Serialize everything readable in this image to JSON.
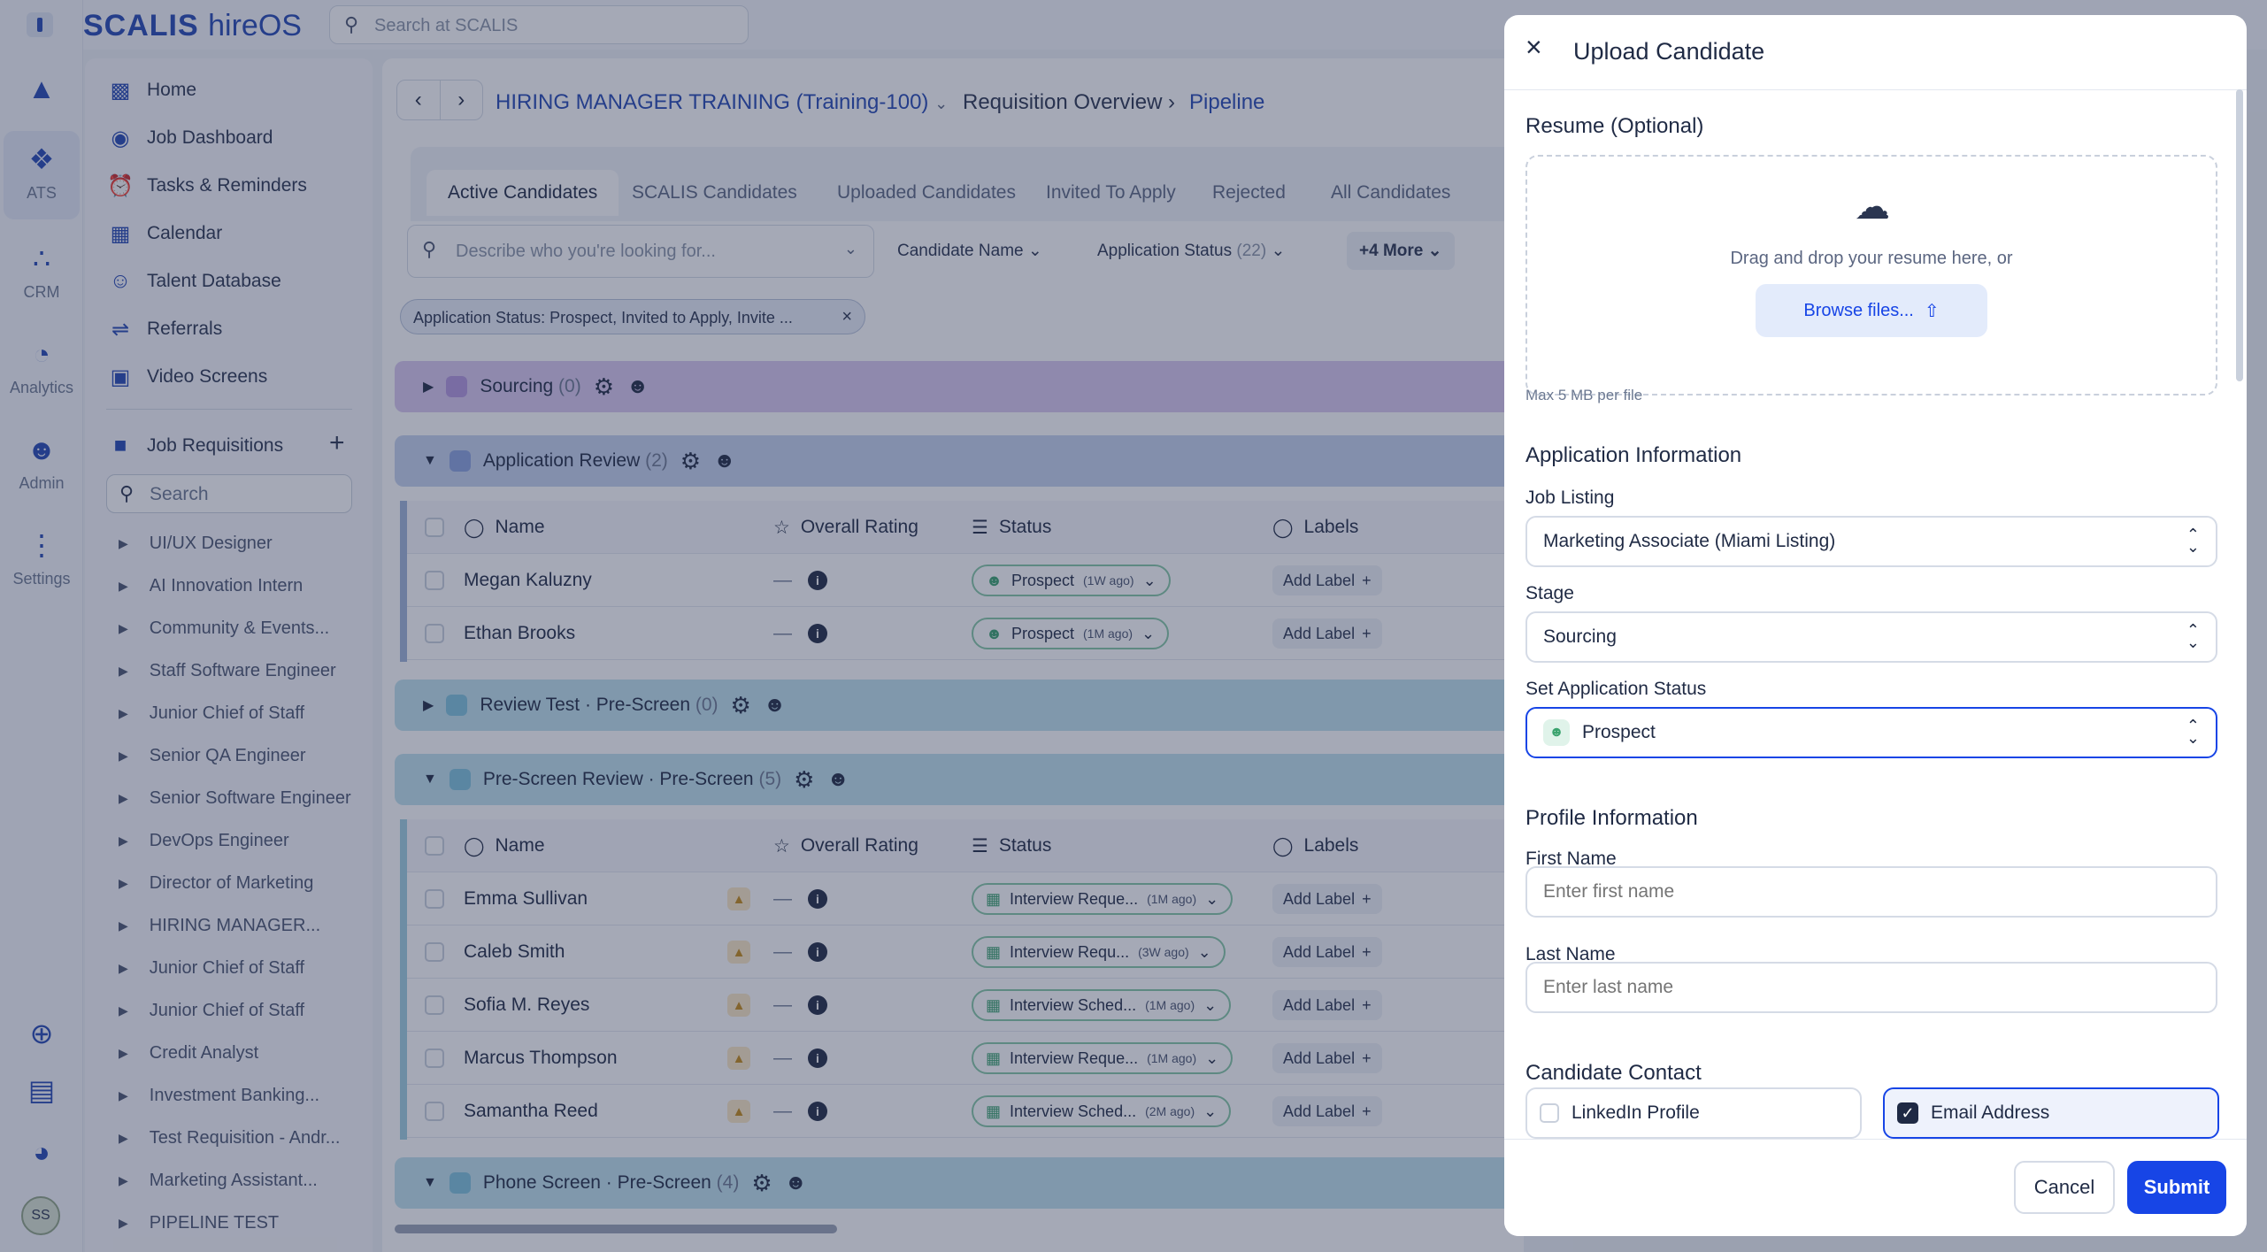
{
  "app": {
    "logo": "SCALIS",
    "logo_suffix": "hireOS",
    "search_placeholder": "Search at SCALIS"
  },
  "rail": {
    "items": [
      {
        "label": "ATS",
        "icon": "ats-icon"
      },
      {
        "label": "CRM",
        "icon": "crm-icon"
      },
      {
        "label": "Analytics",
        "icon": "analytics-icon"
      },
      {
        "label": "Admin",
        "icon": "admin-icon"
      },
      {
        "label": "Settings",
        "icon": "settings-icon"
      }
    ],
    "avatar_initials": "SS"
  },
  "sidebar": {
    "nav": [
      {
        "label": "Home",
        "icon": "home-icon"
      },
      {
        "label": "Job Dashboard",
        "icon": "dashboard-icon"
      },
      {
        "label": "Tasks & Reminders",
        "icon": "tasks-icon"
      },
      {
        "label": "Calendar",
        "icon": "calendar-icon"
      },
      {
        "label": "Talent Database",
        "icon": "talent-icon"
      },
      {
        "label": "Referrals",
        "icon": "referrals-icon"
      },
      {
        "label": "Video Screens",
        "icon": "video-icon"
      }
    ],
    "requisitions_title": "Job Requisitions",
    "search_placeholder": "Search",
    "requisitions": [
      "UI/UX Designer",
      "AI Innovation Intern",
      "Community & Events...",
      "Staff Software Engineer",
      "Junior Chief of Staff",
      "Senior QA Engineer",
      "Senior Software Engineer",
      "DevOps Engineer",
      "Director of Marketing",
      "HIRING MANAGER...",
      "Junior Chief of Staff",
      "Junior Chief of Staff",
      "Credit Analyst",
      "Investment Banking...",
      "Test Requisition - Andr...",
      "Marketing Assistant...",
      "PIPELINE TEST"
    ]
  },
  "main": {
    "requisition": "HIRING MANAGER TRAINING (Training-100)",
    "crumb_overview": "Requisition Overview",
    "crumb_pipeline": "Pipeline",
    "tabs": [
      "Active Candidates",
      "SCALIS Candidates",
      "Uploaded Candidates",
      "Invited To Apply",
      "Rejected",
      "All Candidates"
    ],
    "describe_placeholder": "Describe who you're looking for...",
    "filters": {
      "candidate_name": "Candidate Name",
      "app_status": "Application Status",
      "app_status_count": "(22)",
      "more": "+4 More"
    },
    "active_filter": "Application Status: Prospect, Invited to Apply, Invite ...",
    "columns": {
      "name": "Name",
      "rating": "Overall Rating",
      "status": "Status",
      "labels": "Labels"
    },
    "add_label": "Add Label",
    "rating_empty": "—",
    "stages": [
      {
        "name": "Sourcing",
        "count": "(0)"
      },
      {
        "name": "Application Review",
        "count": "(2)"
      },
      {
        "name": "Review Test · Pre-Screen",
        "count": "(0)"
      },
      {
        "name": "Pre-Screen Review · Pre-Screen",
        "count": "(5)"
      },
      {
        "name": "Phone Screen · Pre-Screen",
        "count": "(4)"
      }
    ],
    "app_review_rows": [
      {
        "name": "Megan Kaluzny",
        "status": "Prospect",
        "ago": "(1W ago)"
      },
      {
        "name": "Ethan Brooks",
        "status": "Prospect",
        "ago": "(1M ago)"
      }
    ],
    "prescreen_rows": [
      {
        "name": "Emma Sullivan",
        "status": "Interview Reque...",
        "ago": "(1M ago)"
      },
      {
        "name": "Caleb Smith",
        "status": "Interview Requ...",
        "ago": "(3W ago)"
      },
      {
        "name": "Sofia M. Reyes",
        "status": "Interview Sched...",
        "ago": "(1M ago)"
      },
      {
        "name": "Marcus Thompson",
        "status": "Interview Reque...",
        "ago": "(1M ago)"
      },
      {
        "name": "Samantha Reed",
        "status": "Interview Sched...",
        "ago": "(2M ago)"
      }
    ]
  },
  "modal": {
    "title": "Upload Candidate",
    "resume_label": "Resume (Optional)",
    "drop_text": "Drag and drop your resume here, or",
    "browse_label": "Browse files...",
    "max_size": "Max 5 MB per file",
    "app_info_heading": "Application Information",
    "job_listing_label": "Job Listing",
    "job_listing_value": "Marketing Associate (Miami Listing)",
    "stage_label": "Stage",
    "stage_value": "Sourcing",
    "status_label": "Set Application Status",
    "status_value": "Prospect",
    "profile_heading": "Profile Information",
    "first_name_label": "First Name",
    "first_name_placeholder": "Enter first name",
    "last_name_label": "Last Name",
    "last_name_placeholder": "Enter last name",
    "contact_heading": "Candidate Contact",
    "linkedin_label": "LinkedIn Profile",
    "linkedin_checked": false,
    "email_label": "Email Address",
    "email_checked": true,
    "cancel_label": "Cancel",
    "submit_label": "Submit"
  },
  "colors": {
    "brand": "#2447b3",
    "submit": "#1745e6",
    "sourcing": "#d9c9f0",
    "review": "#c5d3ee",
    "prescreen": "#bfe2ee"
  }
}
